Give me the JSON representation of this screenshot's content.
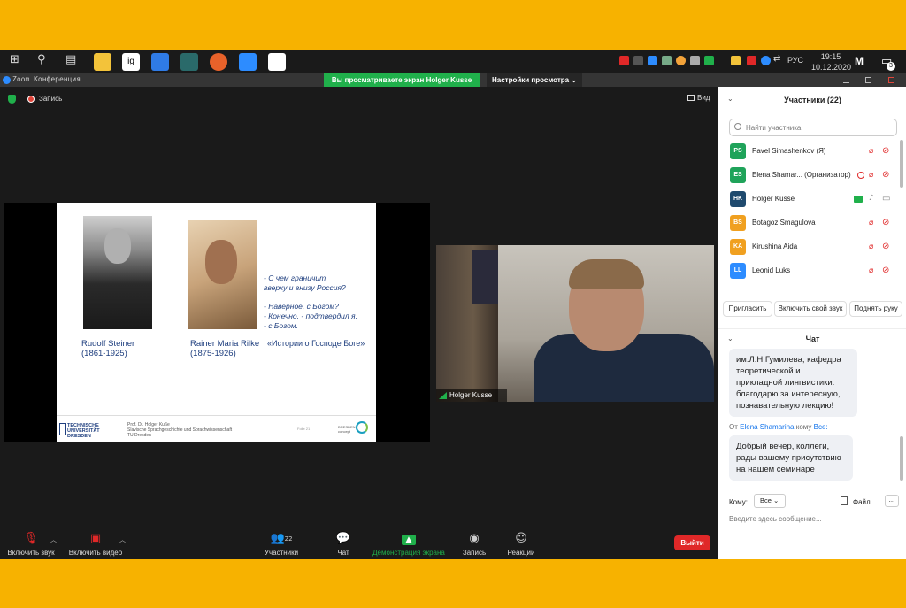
{
  "taskbar": {
    "lang": "РУС",
    "time": "19:15",
    "date": "10.12.2020",
    "logo": "M",
    "notifications": "3",
    "ig_label": "ig"
  },
  "window": {
    "app_title": "Zoom Конференция",
    "share_banner": "Вы просматриваете экран Holger Kusse",
    "view_options": "Настройки просмотра ⌄"
  },
  "meeting": {
    "recording": "Запись",
    "view": "Вид"
  },
  "slide": {
    "person1_name": "Rudolf Steiner",
    "person1_years": "(1861-1925)",
    "person2_name": "Rainer Maria Rilke",
    "person2_years": "(1875-1926)",
    "quote_lines": [
      "-     С чем  граничит",
      "вверху и внизу Россия?",
      "- Наверное, с Богом?",
      "-   Конечно, - подтвердил я,",
      "-   с Богом."
    ],
    "book_title": "«Истории о Господе Боге»",
    "uni_logo": [
      "TECHNISCHE",
      "UNIVERSITÄT",
      "DRESDEN"
    ],
    "author_lines": [
      "Prof. Dr. Holger Kuße",
      "Slavische Sprachgeschichte und Sprachwissenschaft",
      "TU Dresden"
    ],
    "slide_num": "Folie 21",
    "dresden_lines": [
      "DRESDEN",
      "concept"
    ]
  },
  "video": {
    "name": "Holger Kusse"
  },
  "toolbar": {
    "mute": "Включить звук",
    "video": "Включить видео",
    "participants": "Участники",
    "participants_count": "22",
    "chat": "Чат",
    "share": "Демонстрация экрана",
    "record": "Запись",
    "reactions": "Реакции",
    "leave": "Выйти"
  },
  "participants_panel": {
    "title": "Участники (22)",
    "search_placeholder": "Найти участника",
    "list": [
      {
        "initials": "PS",
        "name": "Pavel Simashenkov (Я)",
        "color": "#1FA35A"
      },
      {
        "initials": "ES",
        "name": "Elena Shamar... (Организатор)",
        "color": "#1FA35A"
      },
      {
        "initials": "HK",
        "name": "Holger Kusse",
        "color": "#1F4A6E"
      },
      {
        "initials": "BS",
        "name": "Botagoz Smagulova",
        "color": "#F0A020"
      },
      {
        "initials": "KA",
        "name": "Kirushina Aida",
        "color": "#F0A020"
      },
      {
        "initials": "LL",
        "name": "Leonid Luks",
        "color": "#2D8CFF"
      }
    ],
    "invite": "Пригласить",
    "unmute_me": "Включить свой звук",
    "raise_hand": "Поднять руку"
  },
  "chat_panel": {
    "title": "Чат",
    "msg1_lines": [
      "им.Л.Н.Гумилева, кафедра",
      "теоретической и",
      "прикладной лингвистики.",
      "благодарю за интересную,",
      "познавательную лекцию!"
    ],
    "msg2_from_prefix": "От",
    "msg2_from": "Elena Shamarina",
    "msg2_to_prefix": "кому",
    "msg2_to": "Все:",
    "msg2_lines": [
      "Добрый вечер, коллеги,",
      "рады вашему присутствию",
      "на нашем семинаре"
    ],
    "to_label": "Кому:",
    "to_value": "Все",
    "file": "Файл",
    "more": "...",
    "input_placeholder": "Введите здесь сообщение..."
  }
}
